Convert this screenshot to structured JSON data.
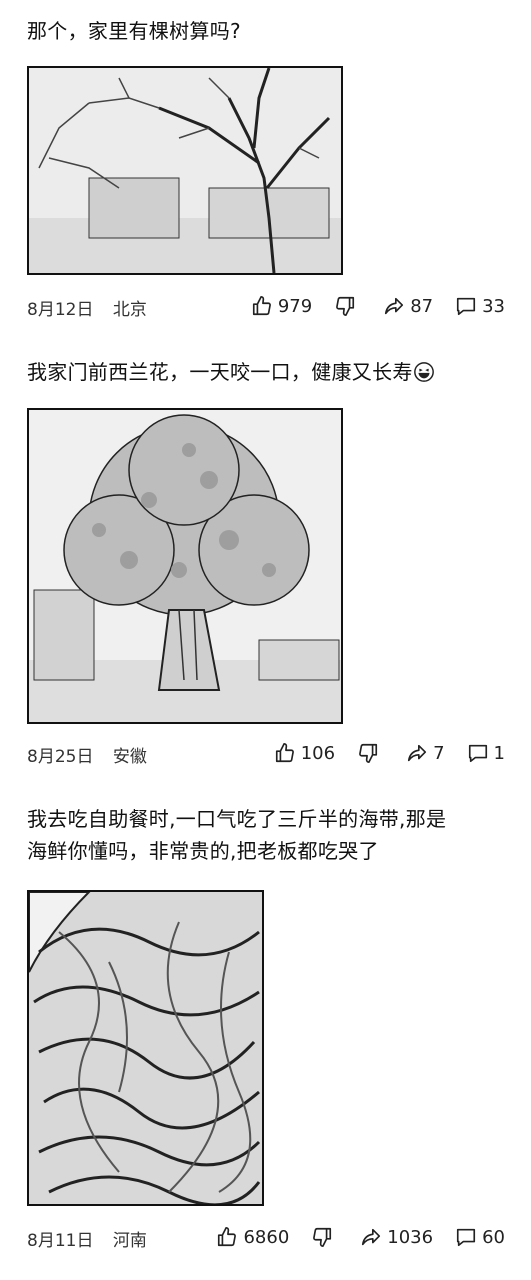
{
  "posts": [
    {
      "text": "那个，家里有棵树算吗?",
      "image": "tree-photo",
      "date": "8月12日",
      "location": "北京",
      "likes": "979",
      "shares": "87",
      "comments": "33"
    },
    {
      "text": "我家门前西兰花，一天咬一口，健康又长寿",
      "emoji": "laughing-tears-emoji",
      "image": "broccoli-tree-photo",
      "date": "8月25日",
      "location": "安徽",
      "likes": "106",
      "shares": "7",
      "comments": "1"
    },
    {
      "text_line1": "我去吃自助餐时,一口气吃了三斤半的海带,那是",
      "text_line2": "海鲜你懂吗，非常贵的,把老板都吃哭了",
      "image": "seaweed-photo",
      "date": "8月11日",
      "location": "河南",
      "likes": "6860",
      "shares": "1036",
      "comments": "60"
    }
  ],
  "icons": {
    "like": "thumbs-up-icon",
    "dislike": "thumbs-down-icon",
    "share": "share-arrow-icon",
    "comment": "comment-bubble-icon"
  }
}
